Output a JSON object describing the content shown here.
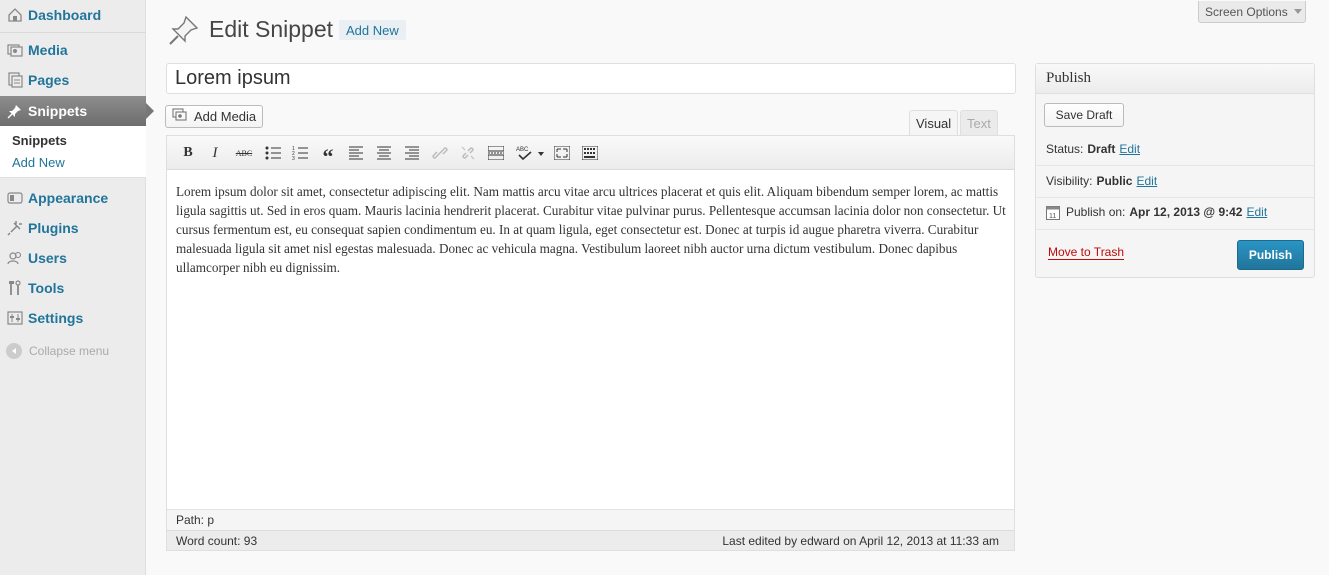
{
  "sidebar": {
    "items": [
      {
        "label": "Dashboard",
        "icon": "dashboard-icon"
      },
      {
        "label": "Media",
        "icon": "media-icon"
      },
      {
        "label": "Pages",
        "icon": "pages-icon"
      },
      {
        "label": "Snippets",
        "icon": "pushpin-icon"
      },
      {
        "label": "Appearance",
        "icon": "appearance-icon"
      },
      {
        "label": "Plugins",
        "icon": "plugins-icon"
      },
      {
        "label": "Users",
        "icon": "users-icon"
      },
      {
        "label": "Tools",
        "icon": "tools-icon"
      },
      {
        "label": "Settings",
        "icon": "settings-icon"
      }
    ],
    "submenu": {
      "current": "Snippets",
      "add_new": "Add New"
    },
    "collapse": "Collapse menu"
  },
  "header": {
    "screen_options": "Screen Options",
    "title": "Edit Snippet",
    "add_new": "Add New"
  },
  "post": {
    "title": "Lorem ipsum",
    "add_media": "Add Media",
    "tabs": {
      "visual": "Visual",
      "text": "Text"
    },
    "content": "Lorem ipsum dolor sit amet, consectetur adipiscing elit. Nam mattis arcu vitae arcu ultrices placerat et quis elit. Aliquam bibendum semper lorem, ac mattis ligula sagittis ut. Sed in eros quam. Mauris lacinia hendrerit placerat. Curabitur vitae pulvinar purus. Pellentesque accumsan lacinia dolor non consectetur. Ut cursus fermentum est, eu consequat sapien condimentum eu. In at quam ligula, eget consectetur est. Donec at turpis id augue pharetra viverra. Curabitur malesuada ligula sit amet nisl egestas malesuada. Donec ac vehicula magna. Vestibulum laoreet nibh auctor urna dictum vestibulum. Donec dapibus ullamcorper nibh eu dignissim.",
    "path": "Path: p",
    "word_count": "Word count: 93",
    "last_edited": "Last edited by edward on April 12, 2013 at 11:33 am"
  },
  "toolbar": {
    "bold": "B",
    "italic": "I",
    "strike": "ABC",
    "blockquote": "“"
  },
  "publish": {
    "heading": "Publish",
    "save_draft": "Save Draft",
    "status_label": "Status:",
    "status_value": "Draft",
    "visibility_label": "Visibility:",
    "visibility_value": "Public",
    "publish_on_label": "Publish on:",
    "publish_on_value": "Apr 12, 2013 @ 9:42",
    "edit": "Edit",
    "move_to_trash": "Move to Trash",
    "publish_button": "Publish"
  },
  "colors": {
    "link": "#21759b",
    "trash": "#bc0b0b",
    "publish_button": "#2a95c5"
  }
}
